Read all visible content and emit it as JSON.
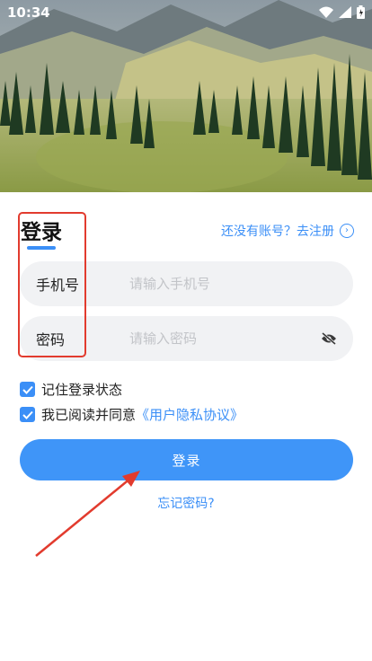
{
  "status_bar": {
    "time": "10:34"
  },
  "header": {
    "title": "登录",
    "register_link": "还没有账号？去注册"
  },
  "form": {
    "phone": {
      "label": "手机号",
      "placeholder": "请输入手机号"
    },
    "password": {
      "label": "密码",
      "placeholder": "请输入密码"
    }
  },
  "options": {
    "remember_label": "记住登录状态",
    "remember_checked": true,
    "agree_label": "我已阅读并同意",
    "agree_link": "《用户隐私协议》",
    "agree_checked": true
  },
  "actions": {
    "login_label": "登录",
    "forgot_label": "忘记密码?"
  },
  "colors": {
    "accent": "#3f95f8",
    "highlight": "#e23b2e"
  },
  "icons": {
    "register_arrow": "chevron-right-circle-icon",
    "password_toggle": "eye-off-icon",
    "checkbox": "check-icon"
  }
}
